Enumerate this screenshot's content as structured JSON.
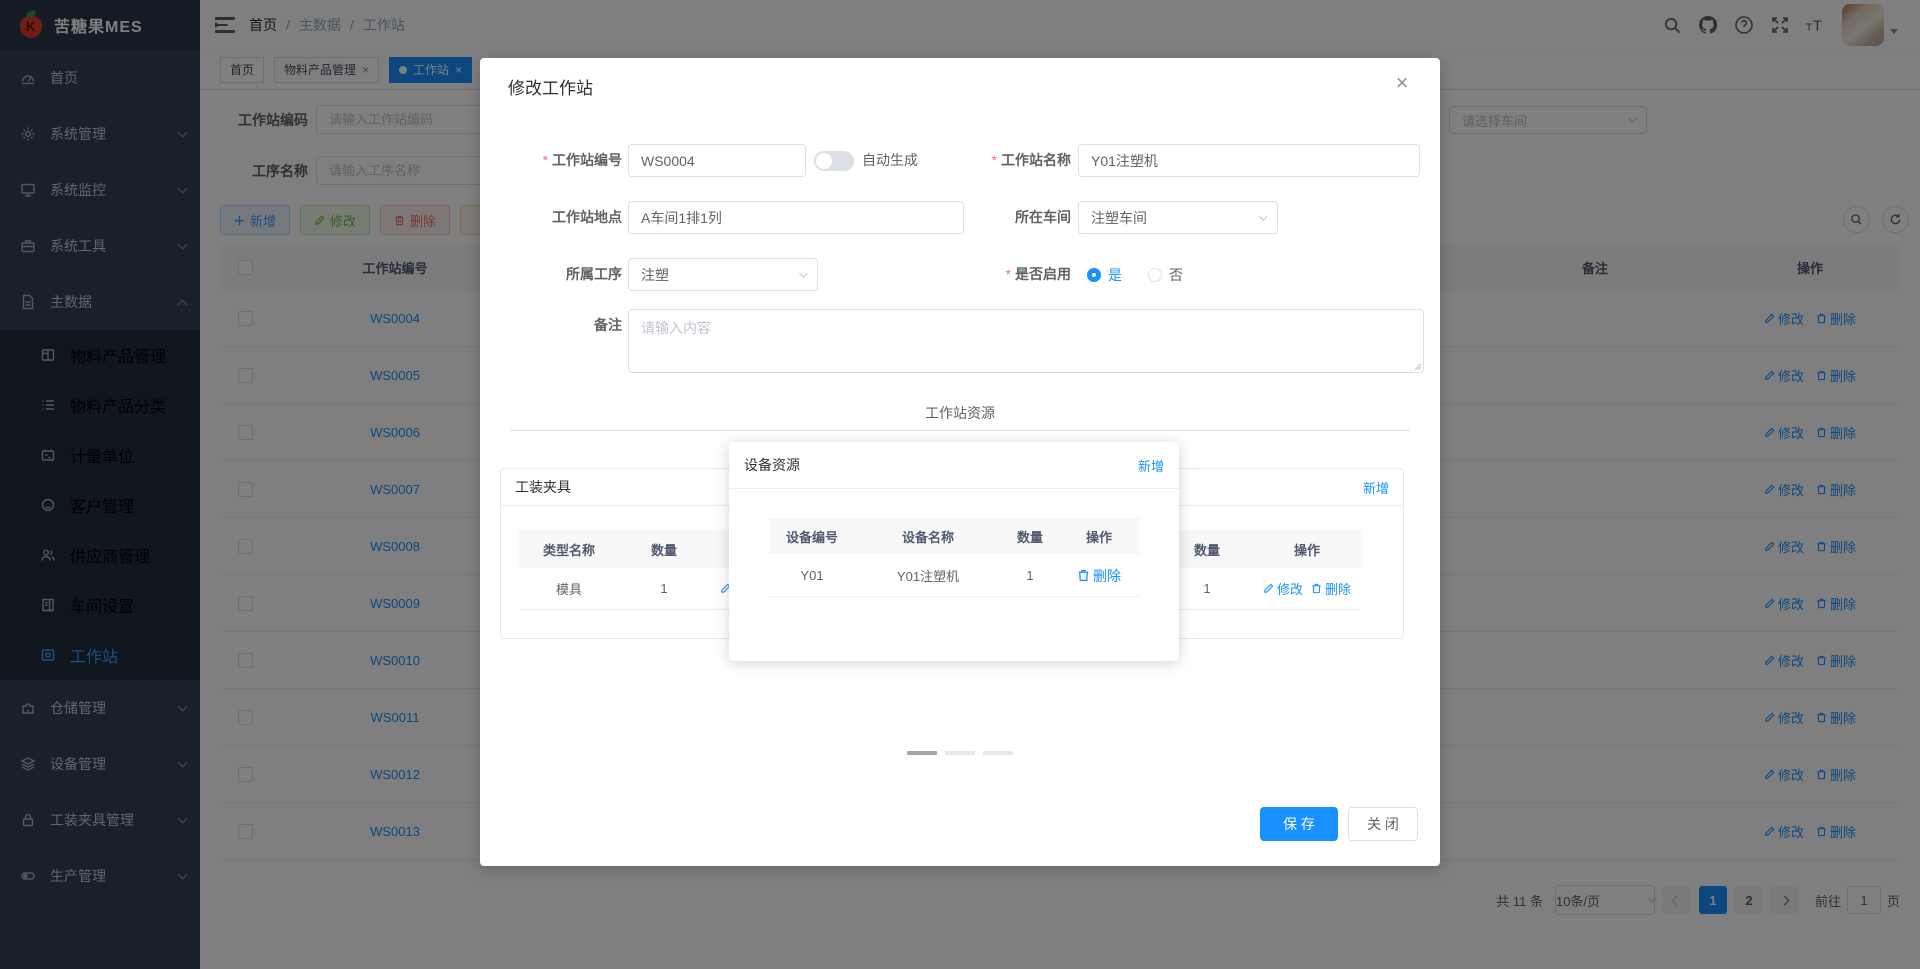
{
  "app": {
    "logo_title": "苦糖果MES"
  },
  "navbar": {
    "breadcrumb": {
      "b0": "首页",
      "sep1": "/",
      "b1": "主数据",
      "sep2": "/",
      "b2": "工作站"
    }
  },
  "tabs": {
    "home": "首页",
    "tab1": "物料产品管理",
    "tab2": "工作站",
    "close_icon": "×"
  },
  "sidebar": {
    "items_before": [
      "首页",
      "系统管理",
      "系统监控",
      "系统工具",
      "主数据"
    ],
    "sub_items": [
      "物料产品管理",
      "物料产品分类",
      "计量单位",
      "客户管理",
      "供应商管理",
      "车间设置",
      "工作站"
    ],
    "items_after": [
      "仓储管理",
      "设备管理",
      "工装夹具管理",
      "生产管理"
    ],
    "active_item": "工作站"
  },
  "search": {
    "code_label": "工作站编码",
    "code_placeholder": "请输入工作站编码",
    "process_label": "工序名称",
    "process_placeholder": "请输入工序名称",
    "workshop_placeholder": "请选择车间"
  },
  "toolbar": {
    "add": "新增",
    "edit": "修改",
    "delete": "删除"
  },
  "table": {
    "headers": {
      "code": "工作站编号",
      "remark": "备注",
      "action": "操作"
    },
    "edit": "修改",
    "delete": "删除",
    "rows": [
      "WS0004",
      "WS0005",
      "WS0006",
      "WS0007",
      "WS0008",
      "WS0009",
      "WS0010",
      "WS0011",
      "WS0012",
      "WS0013"
    ]
  },
  "pagination": {
    "total": "共 11 条",
    "page_size": "10条/页",
    "page1": "1",
    "page2": "2",
    "goto_prefix": "前往",
    "goto_value": "1",
    "goto_suffix": "页"
  },
  "modal": {
    "title": "修改工作站",
    "close_icon": "×",
    "fields": {
      "code_label": "工作站编号",
      "code_value": "WS0004",
      "auto_gen": "自动生成",
      "name_label": "工作站名称",
      "name_value": "Y01注塑机",
      "location_label": "工作站地点",
      "location_value": "A车间1排1列",
      "workshop_label": "所在车间",
      "workshop_value": "注塑车间",
      "process_label": "所属工序",
      "process_value": "注塑",
      "enabled_label": "是否启用",
      "enabled_yes": "是",
      "enabled_no": "否",
      "remark_label": "备注",
      "remark_placeholder": "请输入内容"
    },
    "section_title": "工作站资源",
    "fixture_panel": {
      "title": "工装夹具",
      "col_type": "类型名称",
      "col_qty": "数量",
      "col_action": "操作",
      "row_type": "模具",
      "row_qty": "1",
      "edit": "修改",
      "delete": "删除"
    },
    "device_panel": {
      "title": "设备资源",
      "add": "新增",
      "col_code": "设备编号",
      "col_name": "设备名称",
      "col_qty": "数量",
      "col_action": "操作",
      "row_code": "Y01",
      "row_name": "Y01注塑机",
      "row_qty": "1",
      "delete": "删除"
    },
    "right_panel": {
      "add": "新增",
      "col_qty": "数量",
      "col_action": "操作",
      "row_qty": "1",
      "edit": "修改",
      "delete": "删除"
    },
    "save": "保 存",
    "close": "关 闭"
  }
}
